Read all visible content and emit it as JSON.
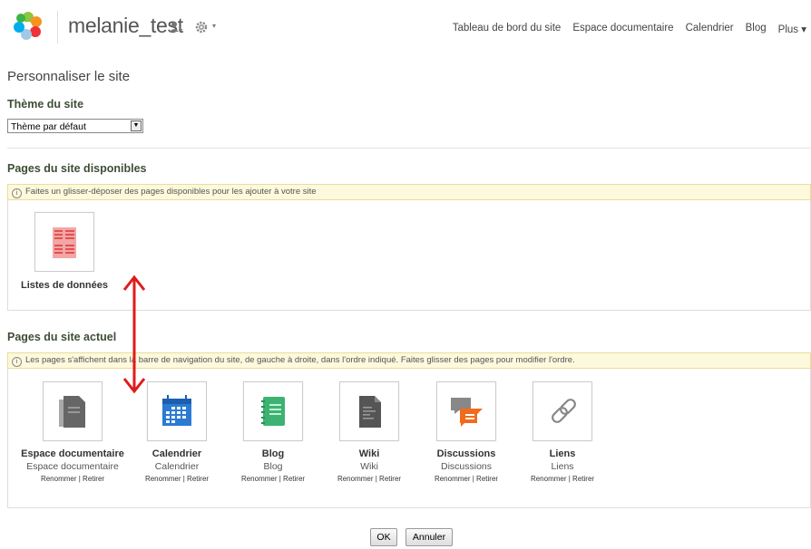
{
  "header": {
    "site_title": "melanie_test",
    "nav": [
      "Tableau de bord du site",
      "Espace documentaire",
      "Calendrier",
      "Blog",
      "Plus ▾"
    ]
  },
  "page_title": "Personnaliser le site",
  "theme": {
    "heading": "Thème du site",
    "selected": "Thème par défaut"
  },
  "available": {
    "heading": "Pages du site disponibles",
    "info": "Faites un glisser-déposer des pages disponibles pour les ajouter à votre site",
    "pages": [
      {
        "title": "Listes de données",
        "icon": "data-list-icon"
      }
    ]
  },
  "current": {
    "heading": "Pages du site actuel",
    "info": "Les pages s'affichent dans la barre de navigation du site, de gauche à droite, dans l'ordre indiqué. Faites glisser des pages pour modifier l'ordre.",
    "pages": [
      {
        "title": "Espace documentaire",
        "sub": "Espace documentaire",
        "rename": "Renommer",
        "remove": "Retirer",
        "icon": "document-library-icon"
      },
      {
        "title": "Calendrier",
        "sub": "Calendrier",
        "rename": "Renommer",
        "remove": "Retirer",
        "icon": "calendar-icon"
      },
      {
        "title": "Blog",
        "sub": "Blog",
        "rename": "Renommer",
        "remove": "Retirer",
        "icon": "blog-icon"
      },
      {
        "title": "Wiki",
        "sub": "Wiki",
        "rename": "Renommer",
        "remove": "Retirer",
        "icon": "wiki-icon"
      },
      {
        "title": "Discussions",
        "sub": "Discussions",
        "rename": "Renommer",
        "remove": "Retirer",
        "icon": "discussions-icon"
      },
      {
        "title": "Liens",
        "sub": "Liens",
        "rename": "Renommer",
        "remove": "Retirer",
        "icon": "links-icon"
      }
    ]
  },
  "buttons": {
    "ok": "OK",
    "cancel": "Annuler"
  },
  "colors": {
    "accent": "#3d4e35",
    "annotation_arrow": "#e01b1b",
    "info_bg": "#fdf9dd"
  }
}
